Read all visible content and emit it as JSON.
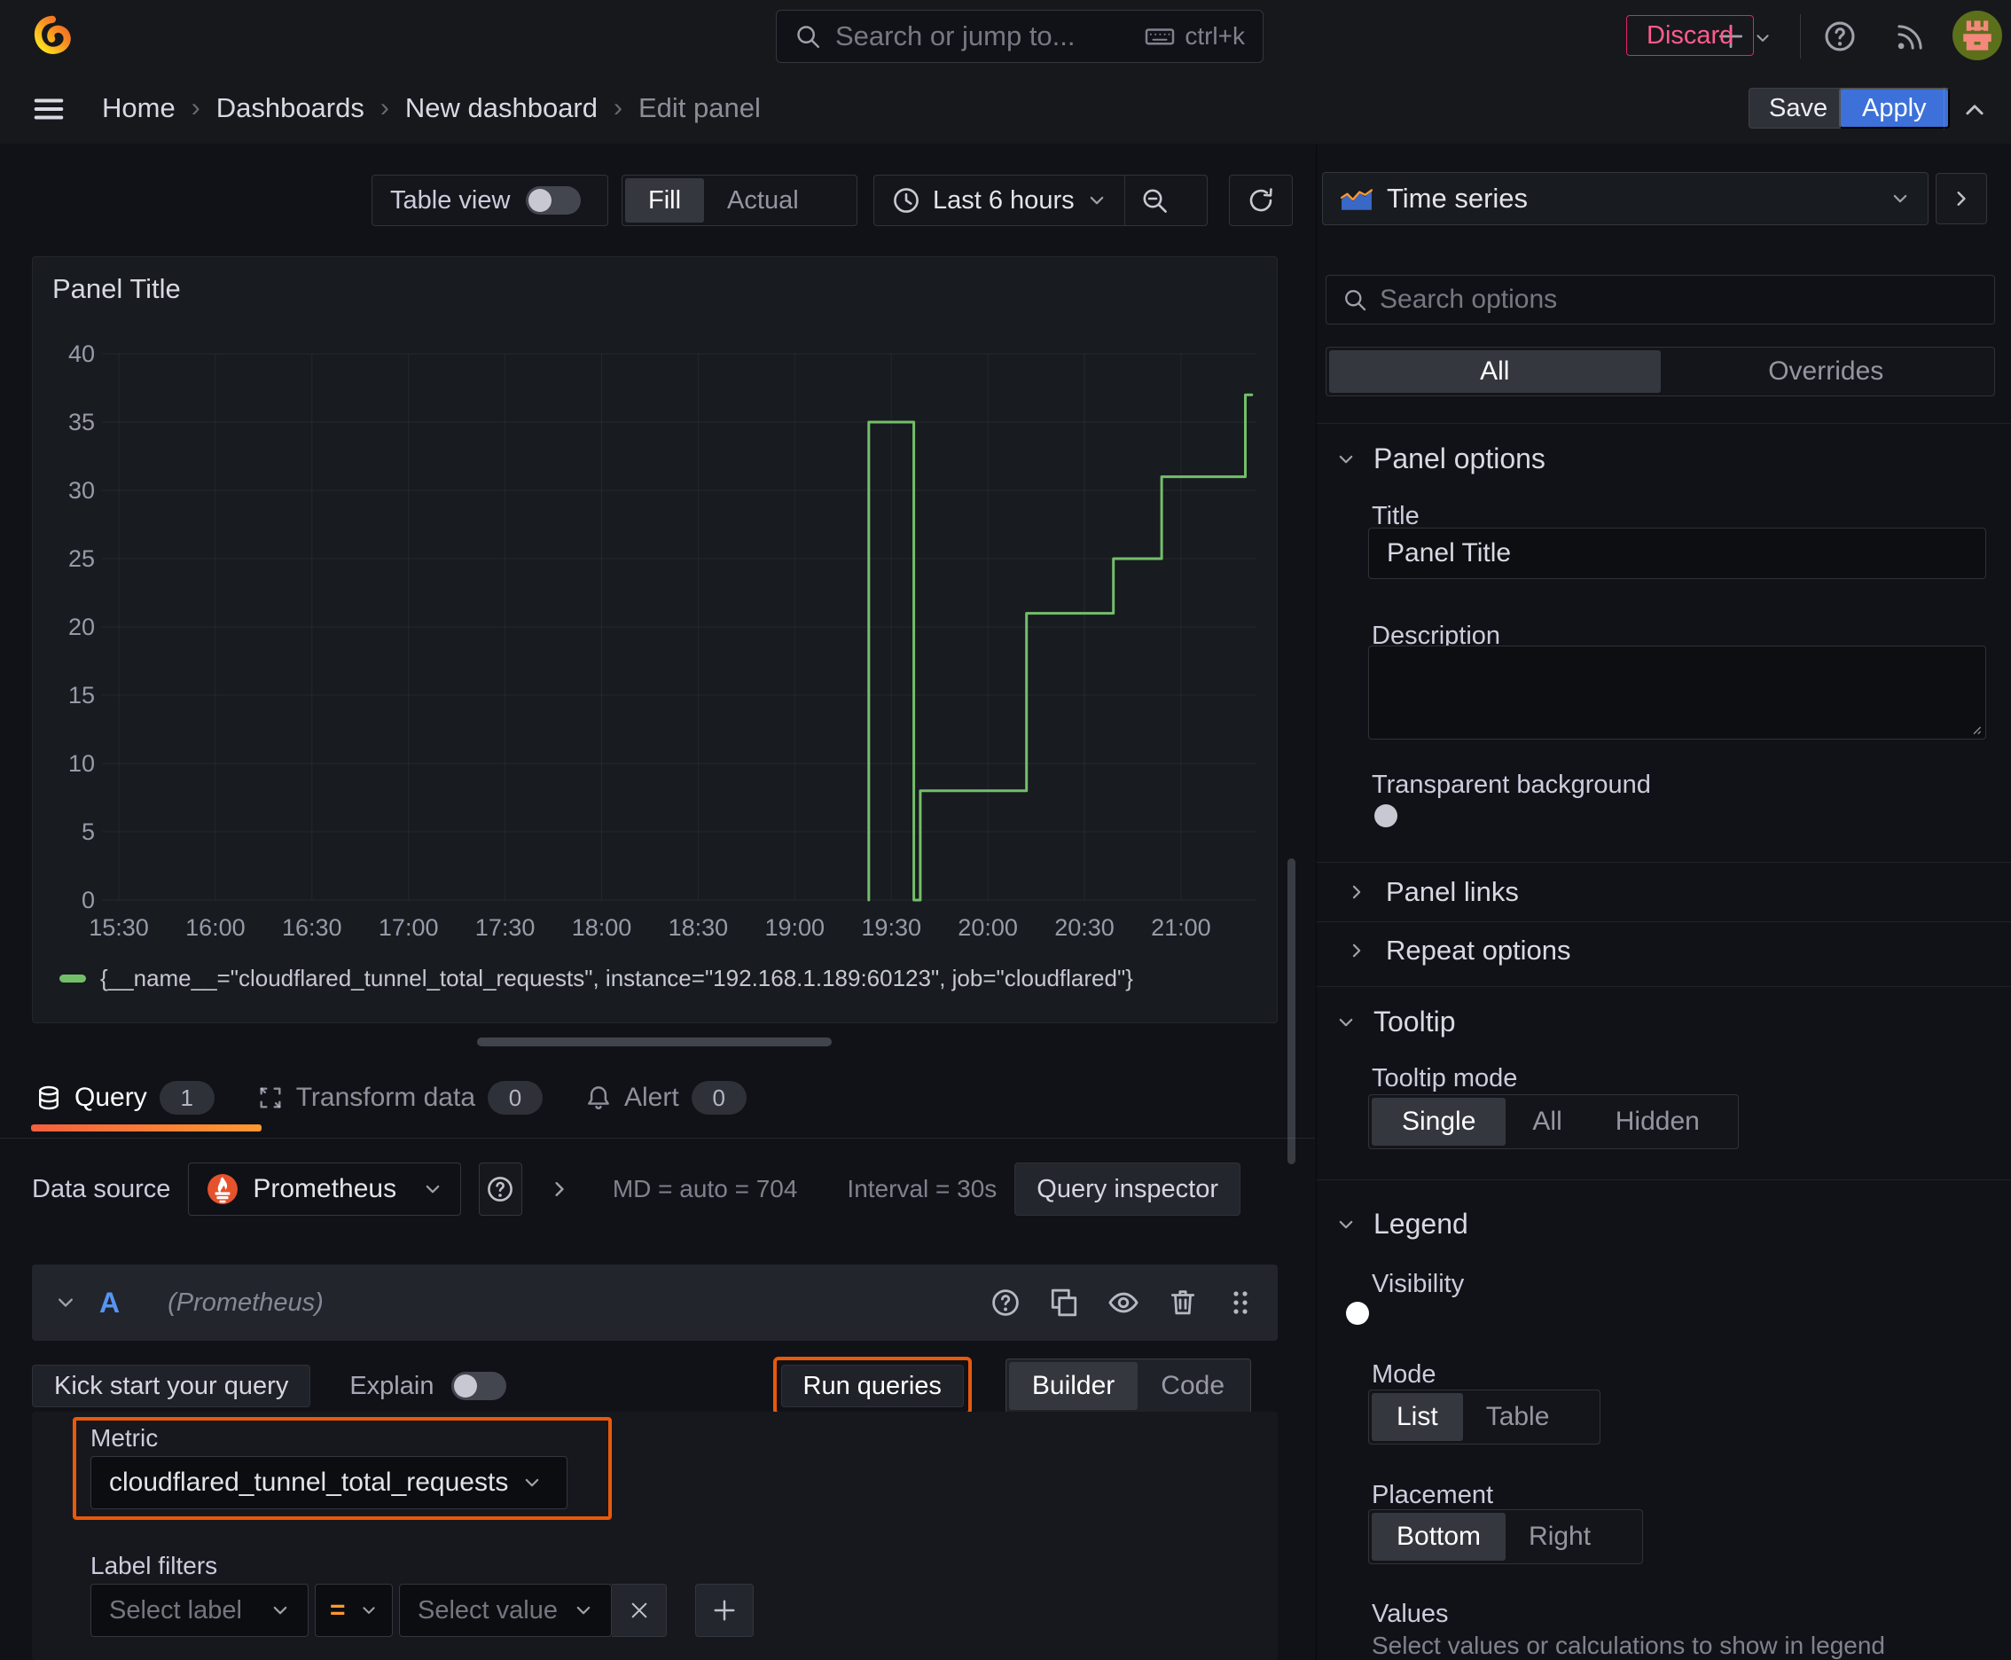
{
  "topbar": {
    "search_placeholder": "Search or jump to...",
    "search_shortcut": "ctrl+k"
  },
  "breadcrumb": {
    "separator": "›",
    "items": [
      "Home",
      "Dashboards",
      "New dashboard",
      "Edit panel"
    ]
  },
  "header_actions": {
    "discard": "Discard",
    "save": "Save",
    "apply": "Apply"
  },
  "toolbar": {
    "table_view": "Table view",
    "fill": "Fill",
    "actual": "Actual",
    "time_range": "Last 6 hours"
  },
  "panel": {
    "title": "Panel Title"
  },
  "chart_data": {
    "type": "line",
    "title": "Panel Title",
    "x_tick_labels": [
      "15:30",
      "16:00",
      "16:30",
      "17:00",
      "17:30",
      "18:00",
      "18:30",
      "19:00",
      "19:30",
      "20:00",
      "20:30",
      "21:00"
    ],
    "x_tick_minutes": [
      0,
      30,
      60,
      90,
      120,
      150,
      180,
      210,
      240,
      270,
      300,
      330
    ],
    "y_ticks": [
      0,
      5,
      10,
      15,
      20,
      25,
      30,
      35,
      40
    ],
    "ylim": [
      0,
      40
    ],
    "x_range_minutes": [
      -7,
      352
    ],
    "grid": true,
    "legend_position": "bottom",
    "series": [
      {
        "name": "{__name__=\"cloudflared_tunnel_total_requests\", instance=\"192.168.1.189:60123\", job=\"cloudflared\"}",
        "color": "#73bf69",
        "step_points_minutes_value": [
          [
            233,
            0
          ],
          [
            233,
            35
          ],
          [
            247,
            35
          ],
          [
            247,
            0
          ],
          [
            249,
            0
          ],
          [
            249,
            8
          ],
          [
            282,
            8
          ],
          [
            282,
            21
          ],
          [
            309,
            21
          ],
          [
            309,
            25
          ],
          [
            324,
            25
          ],
          [
            324,
            31
          ],
          [
            350,
            31
          ],
          [
            350,
            37
          ],
          [
            352,
            37
          ]
        ]
      }
    ]
  },
  "tabs": {
    "query": {
      "label": "Query",
      "count": "1"
    },
    "transform": {
      "label": "Transform data",
      "count": "0"
    },
    "alert": {
      "label": "Alert",
      "count": "0"
    }
  },
  "query_editor": {
    "datasource_label": "Data source",
    "datasource_value": "Prometheus",
    "stats_md": "MD = auto = 704",
    "stats_interval": "Interval = 30s",
    "query_inspector": "Query inspector",
    "ref_id": "A",
    "ref_datasource": "(Prometheus)",
    "kick_start": "Kick start your query",
    "explain": "Explain",
    "run_queries": "Run queries",
    "builder": "Builder",
    "code": "Code",
    "metric_label": "Metric",
    "metric_value": "cloudflared_tunnel_total_requests",
    "label_filters": "Label filters",
    "select_label_placeholder": "Select label",
    "operator": "=",
    "select_value_placeholder": "Select value"
  },
  "options_pane": {
    "viz_type": "Time series",
    "search_placeholder": "Search options",
    "tab_all": "All",
    "tab_overrides": "Overrides",
    "panel_options": {
      "header": "Panel options",
      "title_label": "Title",
      "title_value": "Panel Title",
      "description_label": "Description",
      "transparent_bg": "Transparent background"
    },
    "collapsed": {
      "panel_links": "Panel links",
      "repeat_options": "Repeat options"
    },
    "tooltip": {
      "header": "Tooltip",
      "mode_label": "Tooltip mode",
      "single": "Single",
      "all": "All",
      "hidden": "Hidden"
    },
    "legend": {
      "header": "Legend",
      "visibility": "Visibility",
      "mode_label": "Mode",
      "list": "List",
      "table": "Table",
      "placement_label": "Placement",
      "bottom": "Bottom",
      "right": "Right",
      "values_label": "Values",
      "values_hint": "Select values or calculations to show in legend"
    }
  },
  "colors": {
    "accent_orange": "#ff780a",
    "highlight_box": "#e8590c",
    "series_green": "#73bf69",
    "primary_blue": "#3d71d9",
    "destructive": "#e0226e"
  }
}
